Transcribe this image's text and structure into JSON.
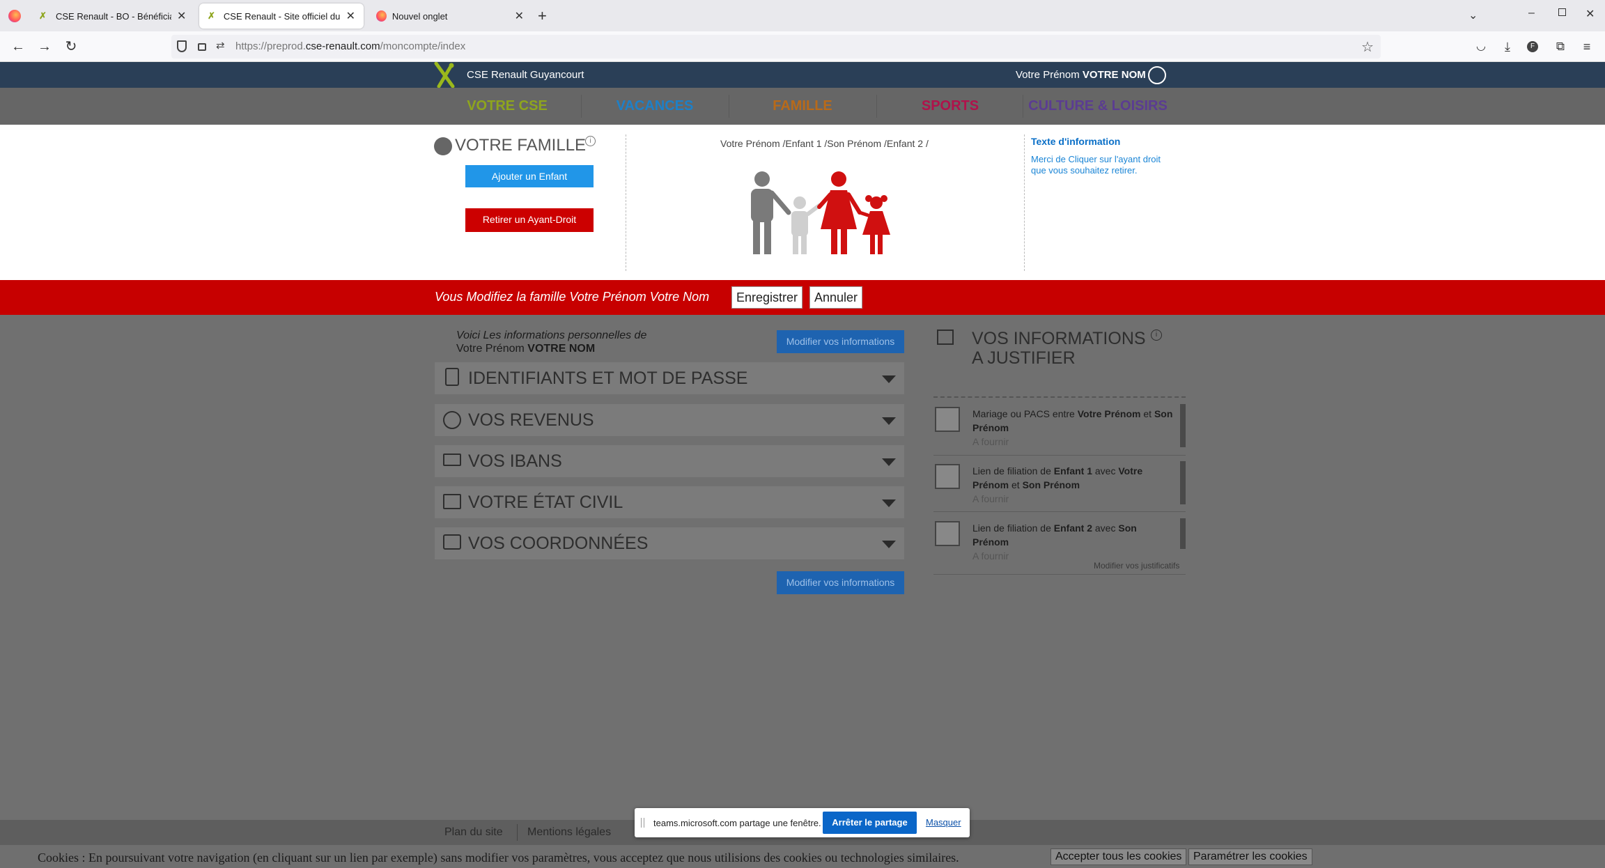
{
  "browser": {
    "tabs": [
      {
        "label": "CSE Renault - BO - Bénéficiaires",
        "active": false
      },
      {
        "label": "CSE Renault - Site officiel du Co",
        "active": true
      },
      {
        "label": "Nouvel onglet",
        "active": false
      }
    ],
    "url_prefix": "https://preprod.",
    "url_domain": "cse-renault.com",
    "url_path": "/moncompte/index"
  },
  "site": {
    "title": "CSE Renault Guyancourt",
    "user_first": "Votre Prénom",
    "user_last": "VOTRE NOM"
  },
  "menu": [
    {
      "label": "VOTRE CSE",
      "color": "#8ea51e"
    },
    {
      "label": "VACANCES",
      "color": "#1d80c8"
    },
    {
      "label": "FAMILLE",
      "color": "#b86a1a"
    },
    {
      "label": "SPORTS",
      "color": "#b0124b"
    },
    {
      "label": "CULTURE & LOISIRS",
      "color": "#5b3c92"
    }
  ],
  "family": {
    "title": "VOTRE FAMILLE",
    "add_child": "Ajouter un Enfant",
    "remove": "Retirer un Ayant-Droit",
    "breadcrumb": "Votre Prénom /Enfant 1 /Son Prénom /Enfant 2 /",
    "info_title": "Texte d'information",
    "info_body": "Merci de Cliquer sur l'ayant droit que vous souhaitez retirer."
  },
  "editbar": {
    "text": "Vous Modifiez la famille Votre Prénom Votre Nom",
    "save": "Enregistrer",
    "cancel": "Annuler"
  },
  "personal": {
    "intro_line1": "Voici Les informations personnelles de",
    "intro_first": "Votre Prénom",
    "intro_last": "VOTRE NOM",
    "modify": "Modifier vos informations",
    "sections": [
      "IDENTIFIANTS ET MOT DE PASSE",
      "VOS REVENUS",
      "VOS IBANS",
      "VOTRE ÉTAT CIVIL",
      "VOS COORDONNÉES"
    ]
  },
  "justify": {
    "title_line1": "VOS INFORMATIONS",
    "title_line2": "A JUSTIFIER",
    "items": [
      {
        "p1": "Mariage ou PACS entre ",
        "b1": "Votre Prénom",
        "p2": " et ",
        "b2": "Son Prénom",
        "status": "A fournir"
      },
      {
        "p1": "Lien de filiation de ",
        "b1": "Enfant 1",
        "p2": " avec ",
        "b2": "Votre Prénom",
        "p3": " et ",
        "b3": "Son Prénom",
        "status": "A fournir"
      },
      {
        "p1": "Lien de filiation de ",
        "b1": "Enfant 2",
        "p2": " avec ",
        "b2": "Son Prénom",
        "status": "A fournir"
      }
    ],
    "modify_link": "Modifier vos justificatifs"
  },
  "footer": {
    "links": [
      "Plan du site",
      "Mentions légales"
    ]
  },
  "cookie": {
    "text": "Cookies : En poursuivant votre navigation (en cliquant sur un lien par exemple) sans modifier vos paramètres, vous acceptez que nous utilisions des cookies ou technologies similaires.",
    "accept": "Accepter tous les cookies",
    "settings": "Paramétrer les cookies"
  },
  "share": {
    "text": "teams.microsoft.com partage une fenêtre.",
    "stop": "Arrêter le partage",
    "hide": "Masquer"
  }
}
